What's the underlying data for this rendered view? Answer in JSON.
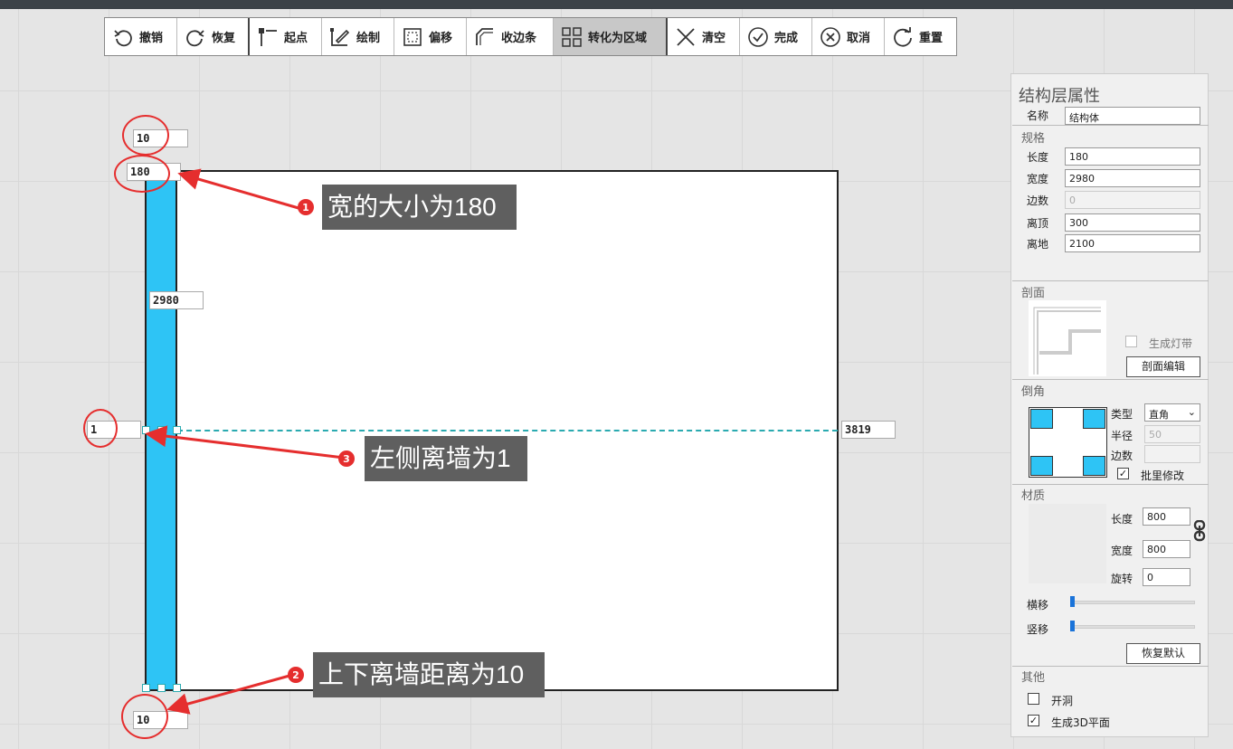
{
  "toolbar": [
    {
      "id": "undo",
      "label": "撤销",
      "icon": "undo-icon"
    },
    {
      "id": "redo",
      "label": "恢复",
      "icon": "redo-icon"
    },
    {
      "id": "start-point",
      "label": "起点",
      "icon": "start-point-icon"
    },
    {
      "id": "draw",
      "label": "绘制",
      "icon": "draw-icon"
    },
    {
      "id": "offset",
      "label": "偏移",
      "icon": "offset-icon"
    },
    {
      "id": "edge-trim",
      "label": "收边条",
      "icon": "edge-trim-icon"
    },
    {
      "id": "to-region",
      "label": "转化为区域",
      "icon": "grid-region-icon"
    },
    {
      "id": "clear",
      "label": "清空",
      "icon": "close-x-icon"
    },
    {
      "id": "finish",
      "label": "完成",
      "icon": "check-circle-icon"
    },
    {
      "id": "cancel",
      "label": "取消",
      "icon": "x-circle-icon"
    },
    {
      "id": "reset",
      "label": "重置",
      "icon": "reset-icon"
    }
  ],
  "canvas": {
    "top_gap": "10",
    "width_value": "180",
    "length_value": "2980",
    "left_gap": "1",
    "right_value": "3819",
    "bottom_gap": "10"
  },
  "annotations": [
    {
      "num": "1",
      "text": "宽的大小为180"
    },
    {
      "num": "2",
      "text": "上下离墙距离为10"
    },
    {
      "num": "3",
      "text": "左侧离墙为1"
    }
  ],
  "panel": {
    "title": "结构层属性",
    "name_label": "名称",
    "name_value": "结构体",
    "spec_title": "规格",
    "spec": [
      {
        "label": "长度",
        "value": "180"
      },
      {
        "label": "宽度",
        "value": "2980"
      },
      {
        "label": "边数",
        "value": "0"
      },
      {
        "label": "离顶",
        "value": "300"
      },
      {
        "label": "离地",
        "value": "2100"
      }
    ],
    "section_title": "剖面",
    "light_strip_label": "生成灯带",
    "section_edit_button": "剖面编辑",
    "chamfer_title": "倒角",
    "chamfer_type_label": "类型",
    "chamfer_type_value": "直角",
    "radius_label": "半径",
    "radius_value": "50",
    "sides_label": "边数",
    "sides_value": "",
    "batch_label": "批里修改",
    "material_title": "材质",
    "mat_length_label": "长度",
    "mat_length_value": "800",
    "mat_width_label": "宽度",
    "mat_width_value": "800",
    "rotate_label": "旋转",
    "rotate_value": "0",
    "hshift_label": "横移",
    "vshift_label": "竖移",
    "restore_button": "恢复默认",
    "other_title": "其他",
    "opening_label": "开洞",
    "gen3d_label": "生成3D平面"
  },
  "colors": {
    "accent": "#2ec4f5",
    "annotation": "#e52e2e",
    "note_bg": "#5f5f5f",
    "slider": "#1a73d9"
  }
}
